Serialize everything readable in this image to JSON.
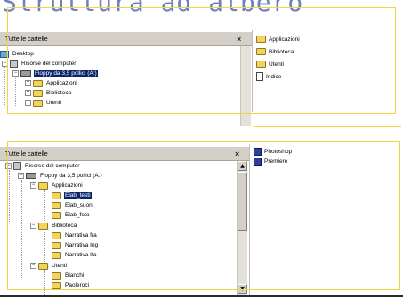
{
  "slide": {
    "title": "Struttura ad albero"
  },
  "top_explorer": {
    "header": "Tutte le cartelle",
    "close": "×",
    "tree": [
      {
        "label": "Desktop",
        "icon": "desktop-icon",
        "expander": ""
      },
      {
        "label": "Risorse del computer",
        "icon": "computer-icon",
        "expander": "−"
      },
      {
        "label": "Floppy da 3,5 pollici (A:)",
        "icon": "floppy-icon",
        "expander": "−",
        "selected": true
      },
      {
        "label": "Applicazioni",
        "icon": "folder-icon",
        "expander": "+"
      },
      {
        "label": "Biblioteca",
        "icon": "folder-icon",
        "expander": "+"
      },
      {
        "label": "Utenti",
        "icon": "folder-icon",
        "expander": "+"
      }
    ],
    "list": [
      {
        "label": "Applicazioni",
        "icon": "folder-icon"
      },
      {
        "label": "Biblioteca",
        "icon": "folder-icon"
      },
      {
        "label": "Utenti",
        "icon": "folder-icon"
      },
      {
        "label": "Indice",
        "icon": "document-icon"
      }
    ]
  },
  "bottom_explorer": {
    "header": "Tutte le cartelle",
    "close": "×",
    "scroll_up": "▲",
    "scroll_down": "▼",
    "tree": [
      {
        "label": "Risorse del computer",
        "icon": "computer-icon",
        "expander": "−"
      },
      {
        "label": "Floppy da 3,5 pollici (A:)",
        "icon": "floppy-icon",
        "expander": "−"
      },
      {
        "label": "Applicazioni",
        "icon": "folder-icon",
        "expander": "−"
      },
      {
        "label": "Elab_testi",
        "icon": "folder-icon",
        "expander": "",
        "selected": true
      },
      {
        "label": "Elab_suoni",
        "icon": "folder-icon",
        "expander": ""
      },
      {
        "label": "Elab_foto",
        "icon": "folder-icon",
        "expander": ""
      },
      {
        "label": "Biblioteca",
        "icon": "folder-icon",
        "expander": "−"
      },
      {
        "label": "Narrativa fra",
        "icon": "folder-icon",
        "expander": ""
      },
      {
        "label": "Narrativa Ing",
        "icon": "folder-icon",
        "expander": ""
      },
      {
        "label": "Narrativa Ita",
        "icon": "folder-icon",
        "expander": ""
      },
      {
        "label": "Utenti",
        "icon": "folder-icon",
        "expander": "−"
      },
      {
        "label": "Bianchi",
        "icon": "folder-icon",
        "expander": ""
      },
      {
        "label": "Paoleroci",
        "icon": "folder-icon",
        "expander": ""
      }
    ],
    "list": [
      {
        "label": "Photoshop",
        "icon": "app-icon"
      },
      {
        "label": "Premiere",
        "icon": "app-icon"
      }
    ]
  }
}
